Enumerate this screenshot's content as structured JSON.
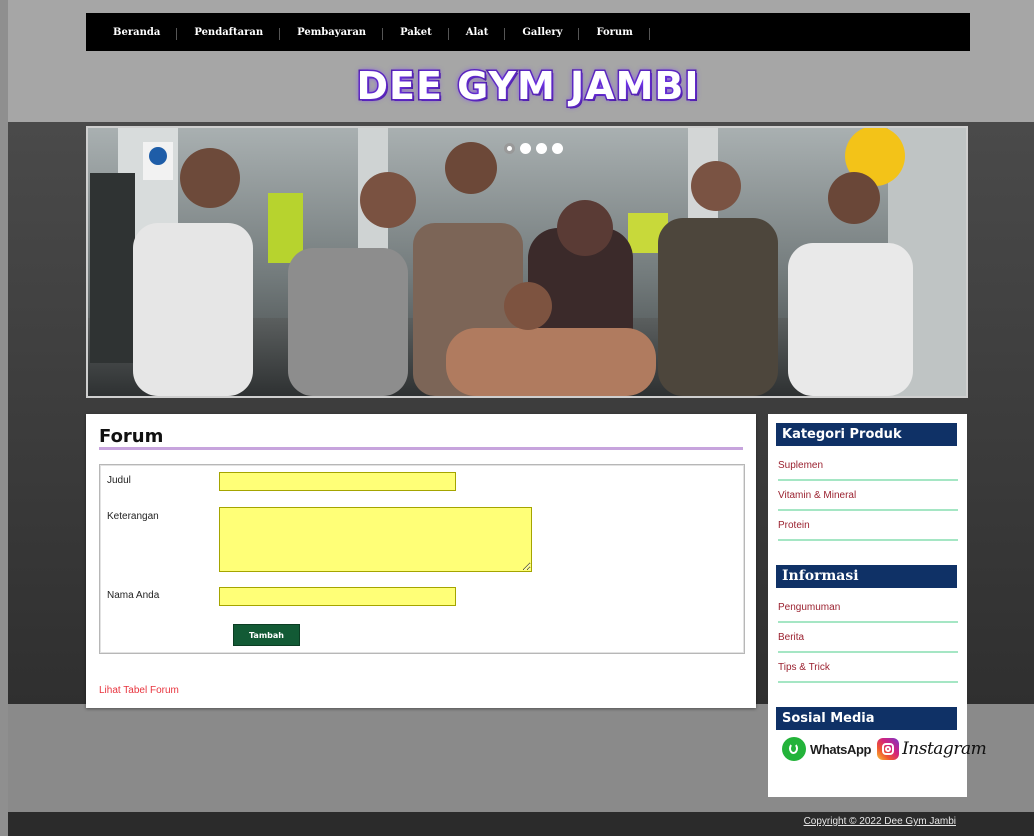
{
  "nav": {
    "items": [
      "Beranda",
      "Pendaftaran",
      "Pembayaran",
      "Paket",
      "Alat",
      "Gallery",
      "Forum"
    ]
  },
  "header": {
    "logo_text": "DEE GYM JAMBI"
  },
  "slider": {
    "dot_count": 4,
    "active_index": 0
  },
  "forum": {
    "title": "Forum",
    "fields": {
      "judul_label": "Judul",
      "judul_value": "",
      "keterangan_label": "Keterangan",
      "keterangan_value": "",
      "nama_label": "Nama Anda",
      "nama_value": ""
    },
    "submit_label": "Tambah",
    "table_link": "Lihat Tabel Forum"
  },
  "sidebar": {
    "kategori": {
      "title": "Kategori Produk",
      "items": [
        "Suplemen",
        "Vitamin & Mineral",
        "Protein"
      ]
    },
    "informasi": {
      "title": "Informasi",
      "items": [
        "Pengumuman",
        "Berita",
        "Tips & Trick"
      ]
    },
    "sosial": {
      "title": "Sosial Media",
      "whatsapp": "WhatsApp",
      "instagram": "Instagram"
    }
  },
  "footer": {
    "copyright": "Copyright © 2022 Dee Gym Jambi"
  },
  "colors": {
    "nav_bg": "#000000",
    "sidebar_header": "#0f3166",
    "input_bg": "#ffff77",
    "button_bg": "#125a35",
    "link": "#e8343e",
    "sidebar_link": "#9b2230",
    "title_rule": "#c7a4dd"
  }
}
